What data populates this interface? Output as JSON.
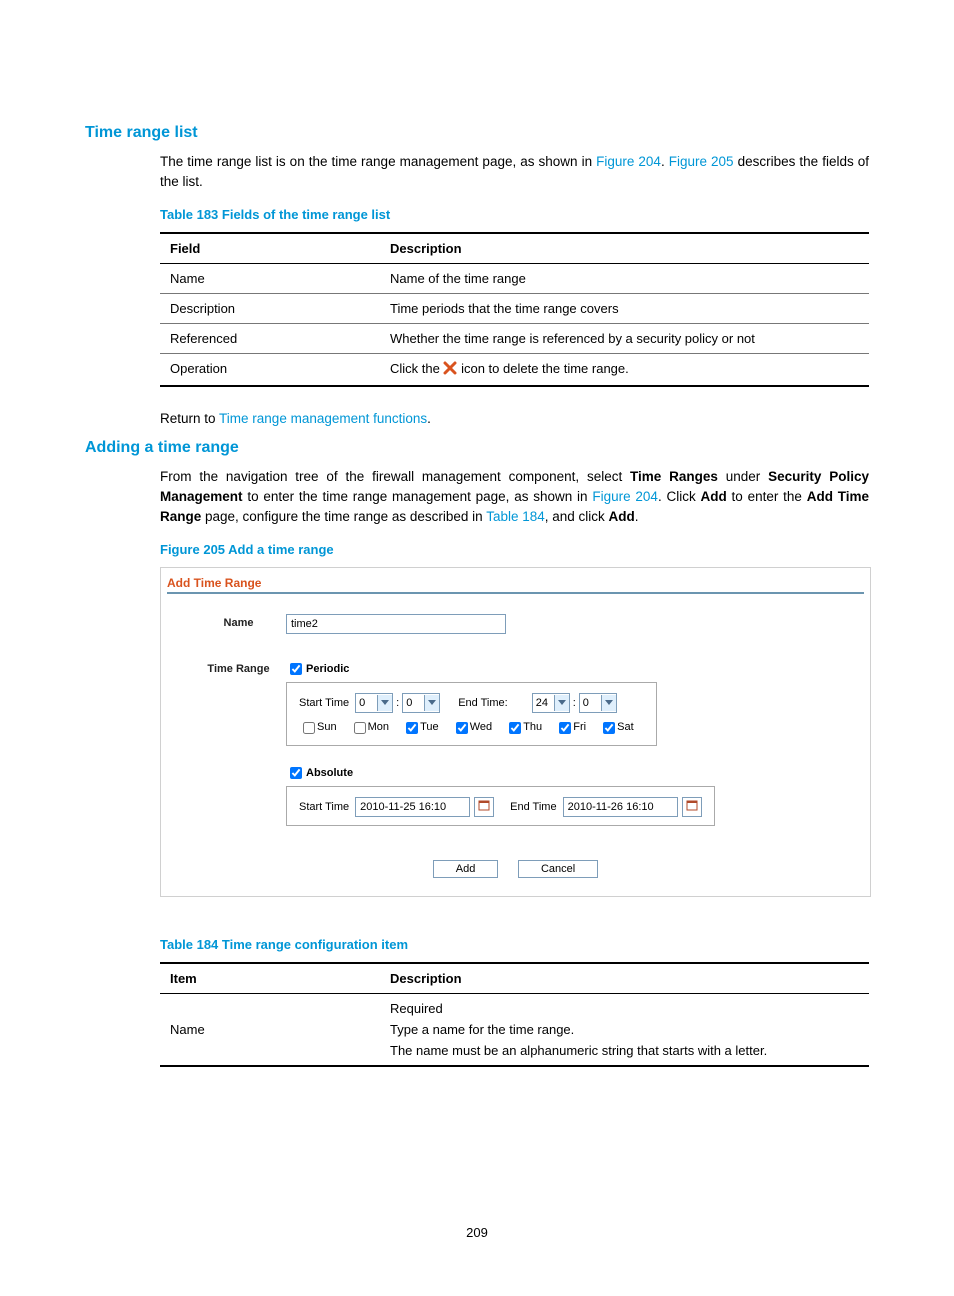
{
  "headings": {
    "section1": "Time range list",
    "section2": "Adding a time range"
  },
  "paras": {
    "p1a": "The time range list is on the time range management page, as shown in ",
    "fig204a": "Figure 204",
    "p1b": ". ",
    "fig205a": "Figure 205",
    "p1c": " describes the fields of the list.",
    "return_a": "Return to ",
    "return_link": "Time range management functions",
    "return_b": ".",
    "p2a": "From the navigation tree of the firewall management component, select ",
    "p2_tr": "Time Ranges",
    "p2b": " under ",
    "p2_spm": "Security Policy Management",
    "p2c": " to enter the time range management page, as shown in ",
    "p2_fig": "Figure 204",
    "p2d": ". Click ",
    "p2_add": "Add",
    "p2e": " to enter the ",
    "p2_atr": "Add Time Range",
    "p2f": " page, configure the time range as described in ",
    "p2_tbl": "Table 184",
    "p2g": ", and click ",
    "p2_add2": "Add",
    "p2h": "."
  },
  "table183": {
    "caption": "Table 183 Fields of the time range list",
    "h1": "Field",
    "h2": "Description",
    "rows": [
      {
        "f": "Name",
        "d": "Name of the time range"
      },
      {
        "f": "Description",
        "d": "Time periods that the time range covers"
      },
      {
        "f": "Referenced",
        "d": "Whether the time range is referenced by a security policy or not"
      },
      {
        "f": "Operation",
        "d_pre": "Click the ",
        "d_post": " icon to delete the time range."
      }
    ]
  },
  "figure205": {
    "caption": "Figure 205 Add a time range",
    "title": "Add Time Range",
    "name_label": "Name",
    "name_value": "time2",
    "tr_label": "Time Range",
    "periodic": "Periodic",
    "start_time": "Start Time",
    "end_time": "End Time:",
    "sh": "0",
    "sm": "0",
    "eh": "24",
    "em": "0",
    "days": {
      "sun": "Sun",
      "mon": "Mon",
      "tue": "Tue",
      "wed": "Wed",
      "thu": "Thu",
      "fri": "Fri",
      "sat": "Sat"
    },
    "absolute": "Absolute",
    "abs_start_lbl": "Start Time",
    "abs_start_val": "2010-11-25 16:10",
    "abs_end_lbl": "End Time",
    "abs_end_val": "2010-11-26 16:10",
    "add_btn": "Add",
    "cancel_btn": "Cancel"
  },
  "table184": {
    "caption": "Table 184 Time range configuration item",
    "h1": "Item",
    "h2": "Description",
    "rows": [
      {
        "f": "Name",
        "d1": "Required",
        "d2": "Type a name for the time range.",
        "d3": "The name must be an alphanumeric string that starts with a letter."
      }
    ]
  },
  "page_number": "209"
}
